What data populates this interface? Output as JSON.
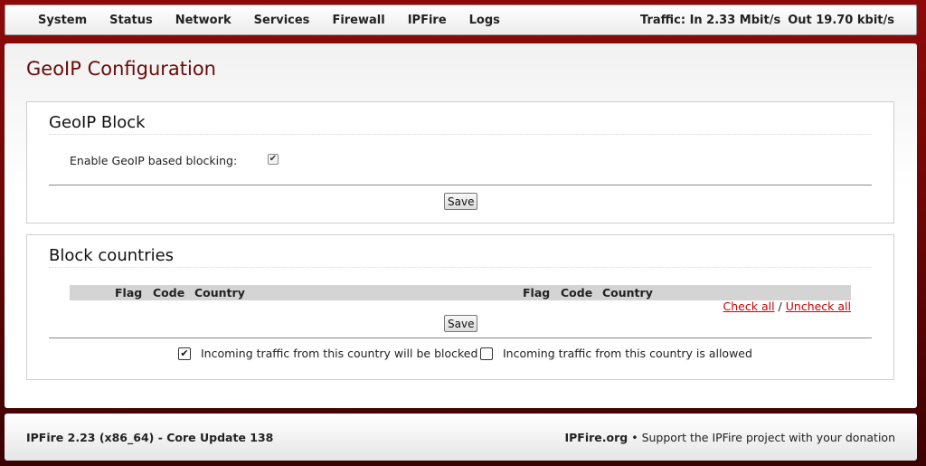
{
  "nav": {
    "items": [
      {
        "label": "System"
      },
      {
        "label": "Status"
      },
      {
        "label": "Network"
      },
      {
        "label": "Services"
      },
      {
        "label": "Firewall"
      },
      {
        "label": "IPFire"
      },
      {
        "label": "Logs"
      }
    ],
    "traffic_in": "Traffic: In 2.33 Mbit/s",
    "traffic_out": "Out 19.70 kbit/s"
  },
  "page": {
    "title": "GeoIP Configuration"
  },
  "geoip_block": {
    "title": "GeoIP Block",
    "enable_label": "Enable GeoIP based blocking:",
    "enabled": true,
    "save_label": "Save"
  },
  "block_countries": {
    "title": "Block countries",
    "columns_left": [
      "Flag",
      "Code",
      "Country"
    ],
    "columns_right": [
      "Flag",
      "Code",
      "Country"
    ],
    "check_all": "Check all",
    "separator": "/",
    "uncheck_all": "Uncheck all",
    "save_label": "Save",
    "legend_blocked": "Incoming traffic from this country will be blocked",
    "legend_allowed": "Incoming traffic from this country is allowed"
  },
  "footer": {
    "version": "IPFire 2.23 (x86_64) - Core Update 138",
    "site": "IPFire.org",
    "support": "• Support the IPFire project with your donation"
  },
  "icons": {
    "check": "checkmark-icon"
  }
}
